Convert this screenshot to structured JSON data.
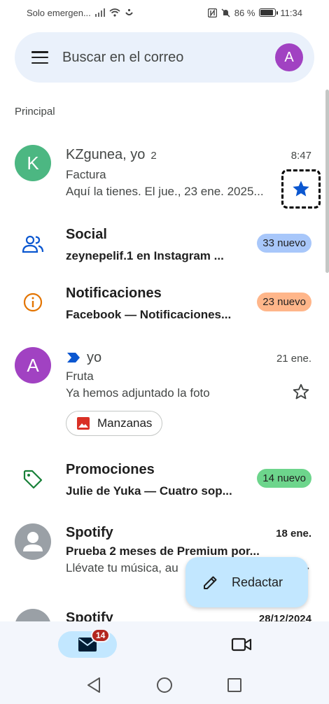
{
  "status_bar": {
    "carrier": "Solo emergen...",
    "battery_text": "86 %",
    "battery_level": 0.86,
    "time": "11:34"
  },
  "search": {
    "placeholder": "Buscar en el correo",
    "avatar_letter": "A"
  },
  "section_label": "Principal",
  "emails": [
    {
      "avatar_letter": "K",
      "avatar_color": "#4cb782",
      "sender": "KZgunea, yo",
      "count": "2",
      "time": "8:47",
      "subject": "Factura",
      "snippet": "Aquí la tienes. El jue., 23 ene. 2025...",
      "starred": true
    },
    {
      "avatar_letter": "A",
      "avatar_color": "#a142c2",
      "sender": "yo",
      "time": "21 ene.",
      "subject": "Fruta",
      "snippet": "Ya hemos adjuntado la foto",
      "attachment": "Manzanas",
      "starred": false
    },
    {
      "sender": "Spotify",
      "time": "18 ene.",
      "subject": "Prueba 2 meses de Premium por...",
      "snippet": "Llévate tu música, au",
      "starred": false
    },
    {
      "sender": "Spotify",
      "time": "28/12/2024"
    }
  ],
  "categories": [
    {
      "name": "Social",
      "preview": "zeynepelif.1 en Instagram ...",
      "badge": "33 nuevo",
      "badge_color": "#a8c7fa",
      "icon": "people-icon",
      "icon_color": "#0b57d0"
    },
    {
      "name": "Notificaciones",
      "preview": "Facebook — Notificaciones...",
      "badge": "23 nuevo",
      "badge_color": "#ffb68a",
      "icon": "info-icon",
      "icon_color": "#e37400"
    },
    {
      "name": "Promociones",
      "preview": "Julie de Yuka — Cuatro sop...",
      "badge": "14 nuevo",
      "badge_color": "#6dd58c",
      "icon": "tag-icon",
      "icon_color": "#188038"
    }
  ],
  "compose": {
    "label": "Redactar"
  },
  "bottom_nav": {
    "mail_badge": "14"
  }
}
